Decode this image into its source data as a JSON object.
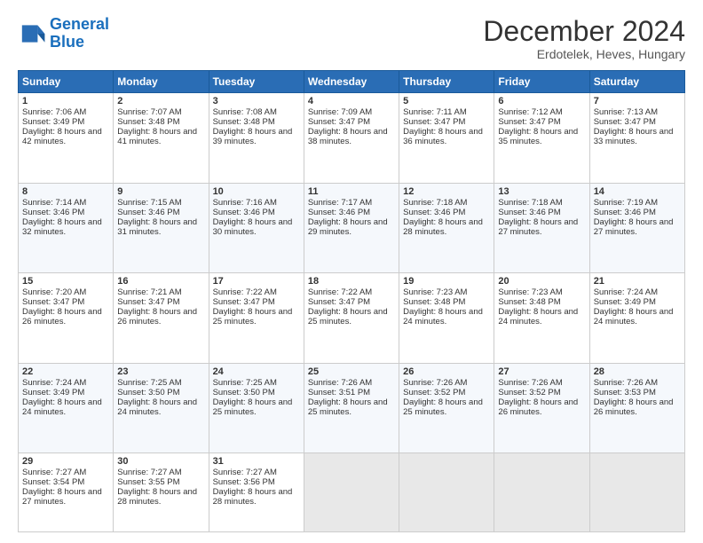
{
  "header": {
    "logo_line1": "General",
    "logo_line2": "Blue",
    "title": "December 2024",
    "subtitle": "Erdotelek, Heves, Hungary"
  },
  "calendar": {
    "headers": [
      "Sunday",
      "Monday",
      "Tuesday",
      "Wednesday",
      "Thursday",
      "Friday",
      "Saturday"
    ],
    "rows": [
      [
        {
          "day": "1",
          "sunrise": "Sunrise: 7:06 AM",
          "sunset": "Sunset: 3:49 PM",
          "daylight": "Daylight: 8 hours and 42 minutes."
        },
        {
          "day": "2",
          "sunrise": "Sunrise: 7:07 AM",
          "sunset": "Sunset: 3:48 PM",
          "daylight": "Daylight: 8 hours and 41 minutes."
        },
        {
          "day": "3",
          "sunrise": "Sunrise: 7:08 AM",
          "sunset": "Sunset: 3:48 PM",
          "daylight": "Daylight: 8 hours and 39 minutes."
        },
        {
          "day": "4",
          "sunrise": "Sunrise: 7:09 AM",
          "sunset": "Sunset: 3:47 PM",
          "daylight": "Daylight: 8 hours and 38 minutes."
        },
        {
          "day": "5",
          "sunrise": "Sunrise: 7:11 AM",
          "sunset": "Sunset: 3:47 PM",
          "daylight": "Daylight: 8 hours and 36 minutes."
        },
        {
          "day": "6",
          "sunrise": "Sunrise: 7:12 AM",
          "sunset": "Sunset: 3:47 PM",
          "daylight": "Daylight: 8 hours and 35 minutes."
        },
        {
          "day": "7",
          "sunrise": "Sunrise: 7:13 AM",
          "sunset": "Sunset: 3:47 PM",
          "daylight": "Daylight: 8 hours and 33 minutes."
        }
      ],
      [
        {
          "day": "8",
          "sunrise": "Sunrise: 7:14 AM",
          "sunset": "Sunset: 3:46 PM",
          "daylight": "Daylight: 8 hours and 32 minutes."
        },
        {
          "day": "9",
          "sunrise": "Sunrise: 7:15 AM",
          "sunset": "Sunset: 3:46 PM",
          "daylight": "Daylight: 8 hours and 31 minutes."
        },
        {
          "day": "10",
          "sunrise": "Sunrise: 7:16 AM",
          "sunset": "Sunset: 3:46 PM",
          "daylight": "Daylight: 8 hours and 30 minutes."
        },
        {
          "day": "11",
          "sunrise": "Sunrise: 7:17 AM",
          "sunset": "Sunset: 3:46 PM",
          "daylight": "Daylight: 8 hours and 29 minutes."
        },
        {
          "day": "12",
          "sunrise": "Sunrise: 7:18 AM",
          "sunset": "Sunset: 3:46 PM",
          "daylight": "Daylight: 8 hours and 28 minutes."
        },
        {
          "day": "13",
          "sunrise": "Sunrise: 7:18 AM",
          "sunset": "Sunset: 3:46 PM",
          "daylight": "Daylight: 8 hours and 27 minutes."
        },
        {
          "day": "14",
          "sunrise": "Sunrise: 7:19 AM",
          "sunset": "Sunset: 3:46 PM",
          "daylight": "Daylight: 8 hours and 27 minutes."
        }
      ],
      [
        {
          "day": "15",
          "sunrise": "Sunrise: 7:20 AM",
          "sunset": "Sunset: 3:47 PM",
          "daylight": "Daylight: 8 hours and 26 minutes."
        },
        {
          "day": "16",
          "sunrise": "Sunrise: 7:21 AM",
          "sunset": "Sunset: 3:47 PM",
          "daylight": "Daylight: 8 hours and 26 minutes."
        },
        {
          "day": "17",
          "sunrise": "Sunrise: 7:22 AM",
          "sunset": "Sunset: 3:47 PM",
          "daylight": "Daylight: 8 hours and 25 minutes."
        },
        {
          "day": "18",
          "sunrise": "Sunrise: 7:22 AM",
          "sunset": "Sunset: 3:47 PM",
          "daylight": "Daylight: 8 hours and 25 minutes."
        },
        {
          "day": "19",
          "sunrise": "Sunrise: 7:23 AM",
          "sunset": "Sunset: 3:48 PM",
          "daylight": "Daylight: 8 hours and 24 minutes."
        },
        {
          "day": "20",
          "sunrise": "Sunrise: 7:23 AM",
          "sunset": "Sunset: 3:48 PM",
          "daylight": "Daylight: 8 hours and 24 minutes."
        },
        {
          "day": "21",
          "sunrise": "Sunrise: 7:24 AM",
          "sunset": "Sunset: 3:49 PM",
          "daylight": "Daylight: 8 hours and 24 minutes."
        }
      ],
      [
        {
          "day": "22",
          "sunrise": "Sunrise: 7:24 AM",
          "sunset": "Sunset: 3:49 PM",
          "daylight": "Daylight: 8 hours and 24 minutes."
        },
        {
          "day": "23",
          "sunrise": "Sunrise: 7:25 AM",
          "sunset": "Sunset: 3:50 PM",
          "daylight": "Daylight: 8 hours and 24 minutes."
        },
        {
          "day": "24",
          "sunrise": "Sunrise: 7:25 AM",
          "sunset": "Sunset: 3:50 PM",
          "daylight": "Daylight: 8 hours and 25 minutes."
        },
        {
          "day": "25",
          "sunrise": "Sunrise: 7:26 AM",
          "sunset": "Sunset: 3:51 PM",
          "daylight": "Daylight: 8 hours and 25 minutes."
        },
        {
          "day": "26",
          "sunrise": "Sunrise: 7:26 AM",
          "sunset": "Sunset: 3:52 PM",
          "daylight": "Daylight: 8 hours and 25 minutes."
        },
        {
          "day": "27",
          "sunrise": "Sunrise: 7:26 AM",
          "sunset": "Sunset: 3:52 PM",
          "daylight": "Daylight: 8 hours and 26 minutes."
        },
        {
          "day": "28",
          "sunrise": "Sunrise: 7:26 AM",
          "sunset": "Sunset: 3:53 PM",
          "daylight": "Daylight: 8 hours and 26 minutes."
        }
      ],
      [
        {
          "day": "29",
          "sunrise": "Sunrise: 7:27 AM",
          "sunset": "Sunset: 3:54 PM",
          "daylight": "Daylight: 8 hours and 27 minutes."
        },
        {
          "day": "30",
          "sunrise": "Sunrise: 7:27 AM",
          "sunset": "Sunset: 3:55 PM",
          "daylight": "Daylight: 8 hours and 28 minutes."
        },
        {
          "day": "31",
          "sunrise": "Sunrise: 7:27 AM",
          "sunset": "Sunset: 3:56 PM",
          "daylight": "Daylight: 8 hours and 28 minutes."
        },
        null,
        null,
        null,
        null
      ]
    ]
  }
}
